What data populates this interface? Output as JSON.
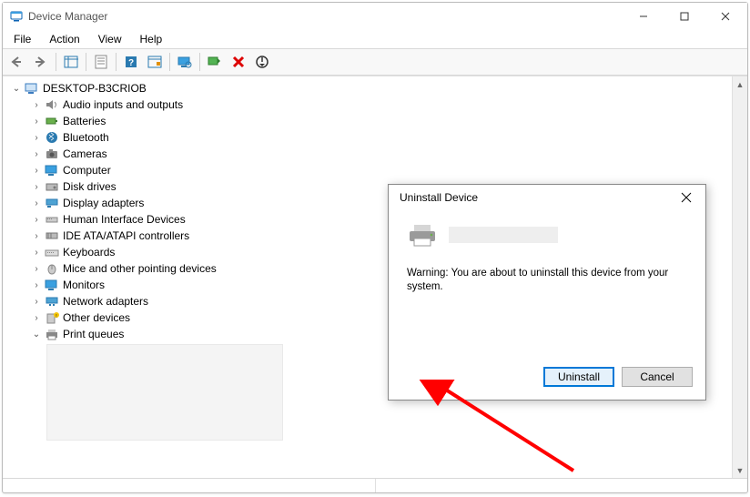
{
  "window": {
    "title": "Device Manager",
    "menus": [
      "File",
      "Action",
      "View",
      "Help"
    ]
  },
  "tree": {
    "root": "DESKTOP-B3CRIOB",
    "items": [
      "Audio inputs and outputs",
      "Batteries",
      "Bluetooth",
      "Cameras",
      "Computer",
      "Disk drives",
      "Display adapters",
      "Human Interface Devices",
      "IDE ATA/ATAPI controllers",
      "Keyboards",
      "Mice and other pointing devices",
      "Monitors",
      "Network adapters",
      "Other devices",
      "Print queues"
    ]
  },
  "dialog": {
    "title": "Uninstall Device",
    "warning": "Warning: You are about to uninstall this device from your system.",
    "primary_button": "Uninstall",
    "secondary_button": "Cancel"
  }
}
